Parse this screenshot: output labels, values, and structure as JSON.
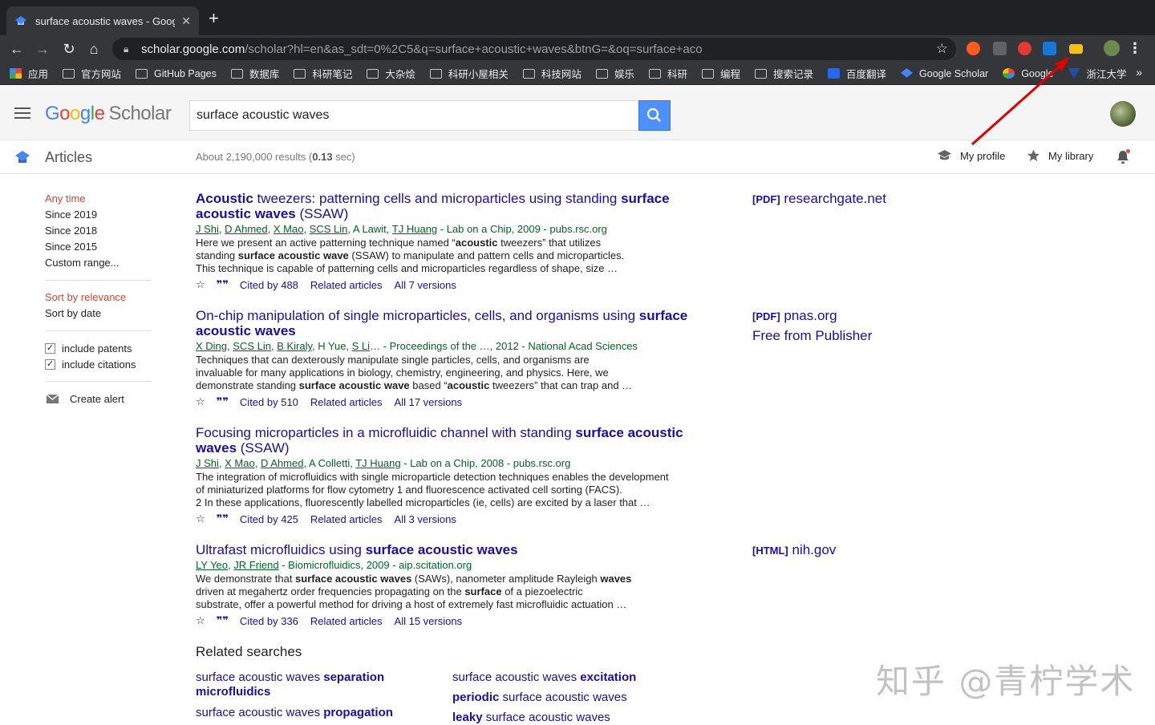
{
  "browser": {
    "tab_title": "surface acoustic waves - Goog",
    "url_host": "scholar.google.com",
    "url_path": "/scholar?hl=en&as_sdt=0%2C5&q=surface+acoustic+waves&btnG=&oq=surface+aco",
    "bookmarks": [
      "应用",
      "官方网站",
      "GitHub Pages",
      "数据库",
      "科研笔记",
      "大杂烩",
      "科研小屋相关",
      "科技网站",
      "娱乐",
      "科研",
      "编程",
      "搜索记录",
      "百度翻译",
      "Google Scholar",
      "Google",
      "浙江大学"
    ],
    "more": "»"
  },
  "header": {
    "logo_letters": [
      "G",
      "o",
      "o",
      "g",
      "l",
      "e"
    ],
    "logo_product": "Scholar",
    "search_value": "surface acoustic waves"
  },
  "subbar": {
    "section": "Articles",
    "results_prefix": "About 2,190,000 results (",
    "results_time": "0.13",
    "results_suffix": " sec)",
    "my_profile": "My profile",
    "my_library": "My library"
  },
  "filters": {
    "time": [
      "Any time",
      "Since 2019",
      "Since 2018",
      "Since 2015",
      "Custom range..."
    ],
    "sort": [
      "Sort by relevance",
      "Sort by date"
    ],
    "checks": [
      "include patents",
      "include citations"
    ],
    "alert": "Create alert"
  },
  "results": [
    {
      "title_html": "<b>Acoustic</b> tweezers: patterning cells and microparticles using standing <b>surface acoustic waves</b> (SSAW)",
      "authors": [
        "J Shi",
        "D Ahmed",
        "X Mao",
        "SCS Lin"
      ],
      "authors_plain": ", A Lawit, ",
      "authors_last": "TJ Huang",
      "source": " - Lab on a Chip, 2009 - pubs.rsc.org",
      "snippet_html": "Here we present an active patterning technique named “<b>acoustic</b> tweezers” that utilizes<br>standing <b>surface acoustic wave</b> (SSAW) to manipulate and pattern cells and microparticles.<br>This technique is capable of patterning cells and microparticles regardless of shape, size …",
      "cited": "Cited by 488",
      "related": "Related articles",
      "versions": "All 7 versions",
      "side": [
        {
          "tag": "[PDF]",
          "text": " researchgate.net"
        }
      ]
    },
    {
      "title_html": "On-chip manipulation of single microparticles, cells, and organisms using <b>surface acoustic waves</b>",
      "authors": [
        "X Ding",
        "SCS Lin",
        "B Kiraly"
      ],
      "authors_plain": ", H Yue, ",
      "authors_last": "S Li",
      "source": "… - Proceedings of the …, 2012 - National Acad Sciences",
      "snippet_html": "Techniques that can dexterously manipulate single particles, cells, and organisms are<br>invaluable for many applications in biology, chemistry, engineering, and physics. Here, we<br>demonstrate standing <b>surface acoustic wave</b> based “<b>acoustic</b> tweezers” that can trap and …",
      "cited": "Cited by 510",
      "related": "Related articles",
      "versions": "All 17 versions",
      "side": [
        {
          "tag": "[PDF]",
          "text": " pnas.org"
        },
        {
          "tag": "",
          "text": "Free from Publisher"
        }
      ]
    },
    {
      "title_html": "Focusing microparticles in a microfluidic channel with standing <b>surface acoustic waves</b> (SSAW)",
      "authors": [
        "J Shi",
        "X Mao",
        "D Ahmed"
      ],
      "authors_plain": ", A Colletti, ",
      "authors_last": "TJ Huang",
      "source": " - Lab on a Chip, 2008 - pubs.rsc.org",
      "snippet_html": "The integration of microfluidics with single microparticle detection techniques enables the development<br>of miniaturized platforms for flow cytometry 1 and fluorescence activated cell sorting (FACS).<br>2 In these applications, fluorescently labelled microparticles (ie, cells) are excited by a laser that …",
      "cited": "Cited by 425",
      "related": "Related articles",
      "versions": "All 3 versions",
      "side": []
    },
    {
      "title_html": "Ultrafast microfluidics using <b>surface acoustic waves</b>",
      "authors": [
        "LY Yeo"
      ],
      "authors_plain": ", ",
      "authors_last": "JR Friend",
      "source": " - Biomicrofluidics, 2009 - aip.scitation.org",
      "snippet_html": "We demonstrate that <b>surface acoustic waves</b> (SAWs), nanometer amplitude Rayleigh <b>waves</b><br>driven at megahertz order frequencies propagating on the <b>surface</b> of a piezoelectric<br>substrate, offer a powerful method for driving a host of extremely fast microfluidic actuation …",
      "cited": "Cited by 336",
      "related": "Related articles",
      "versions": "All 15 versions",
      "side": [
        {
          "tag": "[HTML]",
          "text": " nih.gov"
        }
      ]
    }
  ],
  "related_searches": {
    "title": "Related searches",
    "items": [
      "surface acoustic waves <b>separation microfluidics</b>",
      "surface acoustic waves <b>excitation</b>",
      "surface acoustic waves <b>propagation</b>",
      "<b>periodic</b> surface acoustic waves",
      "<b>leaky</b> surface acoustic waves"
    ]
  },
  "watermark": "知乎 @青柠学术",
  "colors": {
    "link": "#1a0dab",
    "meta": "#006621",
    "accent_red": "#d14836",
    "search_blue": "#4d90fe"
  }
}
